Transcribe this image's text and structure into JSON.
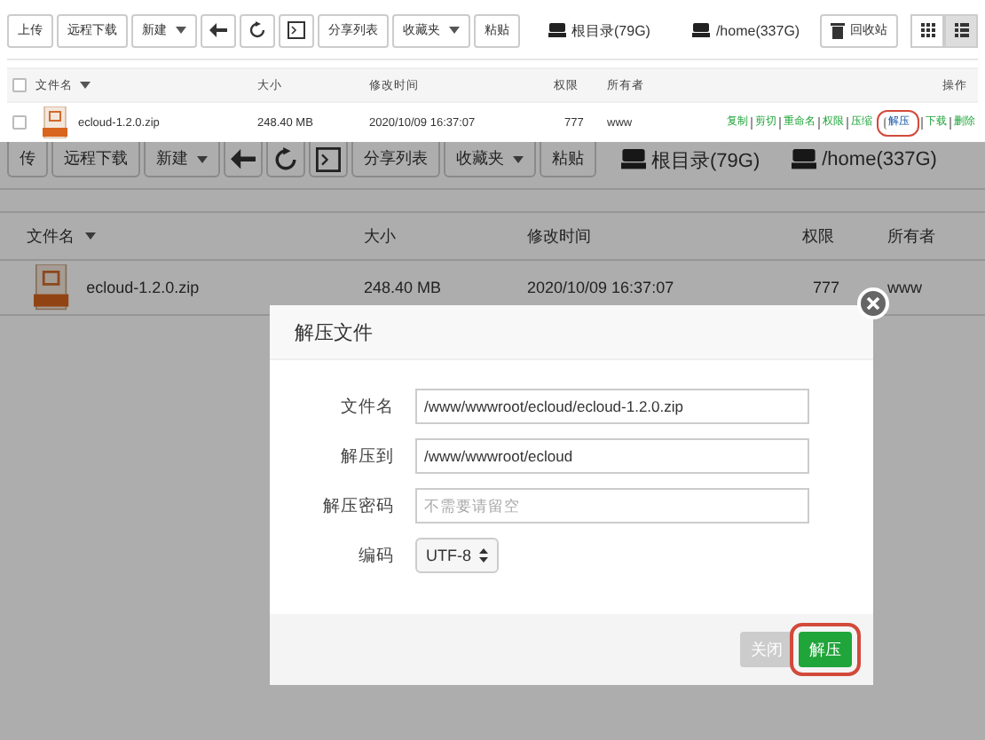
{
  "top_panel": {
    "toolbar": [
      {
        "kind": "text",
        "label": "上传"
      },
      {
        "kind": "text",
        "label": "远程下载"
      },
      {
        "kind": "dropdown",
        "label": "新建"
      },
      {
        "kind": "back"
      },
      {
        "kind": "refresh"
      },
      {
        "kind": "terminal"
      },
      {
        "kind": "text",
        "label": "分享列表"
      },
      {
        "kind": "dropdown",
        "label": "收藏夹"
      },
      {
        "kind": "text",
        "label": "粘贴"
      }
    ],
    "disks": [
      "根目录(79G)",
      "/home(337G)"
    ],
    "recycle_bin": "回收站",
    "views": [
      {
        "kind": "grid",
        "selected": false
      },
      {
        "kind": "list",
        "selected": true
      }
    ],
    "header_checked": false,
    "columns": [
      "文件名",
      "大小",
      "修改时间",
      "权限",
      "所有者",
      "操作"
    ],
    "rows": [
      {
        "checked": false,
        "name": "ecloud-1.2.0.zip",
        "size": "248.40 MB",
        "modified": "2020/10/09 16:37:07",
        "permission": "777",
        "owner": "www",
        "actions": [
          {
            "label": "复制",
            "highlighted": false
          },
          {
            "label": "剪切",
            "highlighted": false
          },
          {
            "label": "重命名",
            "highlighted": false
          },
          {
            "label": "权限",
            "highlighted": false
          },
          {
            "label": "压缩",
            "highlighted": false
          },
          {
            "label": "解压",
            "highlighted": true
          },
          {
            "label": "下载",
            "highlighted": false
          },
          {
            "label": "删除",
            "highlighted": false
          }
        ]
      }
    ]
  },
  "bottom_panel": {
    "toolbar": [
      {
        "kind": "text",
        "label": "传"
      },
      {
        "kind": "text",
        "label": "远程下载"
      },
      {
        "kind": "dropdown",
        "label": "新建"
      },
      {
        "kind": "back"
      },
      {
        "kind": "refresh"
      },
      {
        "kind": "terminal"
      },
      {
        "kind": "text",
        "label": "分享列表"
      },
      {
        "kind": "dropdown",
        "label": "收藏夹"
      },
      {
        "kind": "text",
        "label": "粘贴"
      }
    ],
    "disks": [
      "根目录(79G)",
      "/home(337G)"
    ],
    "columns": [
      "文件名",
      "大小",
      "修改时间",
      "权限",
      "所有者"
    ],
    "rows": [
      {
        "name": "ecloud-1.2.0.zip",
        "size": "248.40 MB",
        "modified": "2020/10/09 16:37:07",
        "permission": "777",
        "owner": "www"
      }
    ],
    "dialog": {
      "title": "解压文件",
      "fields": [
        {
          "kind": "input",
          "label": "文件名",
          "value": "/www/wwwroot/ecloud/ecloud-1.2.0.zip"
        },
        {
          "kind": "input",
          "label": "解压到",
          "value": "/www/wwwroot/ecloud"
        },
        {
          "kind": "input",
          "label": "解压密码",
          "placeholder": "不需要请留空"
        },
        {
          "kind": "select",
          "label": "编码",
          "value": "UTF-8"
        }
      ],
      "buttons": [
        {
          "kind": "secondary",
          "label": "关闭",
          "highlighted": false
        },
        {
          "kind": "primary",
          "label": "解压",
          "highlighted": true
        }
      ]
    }
  }
}
